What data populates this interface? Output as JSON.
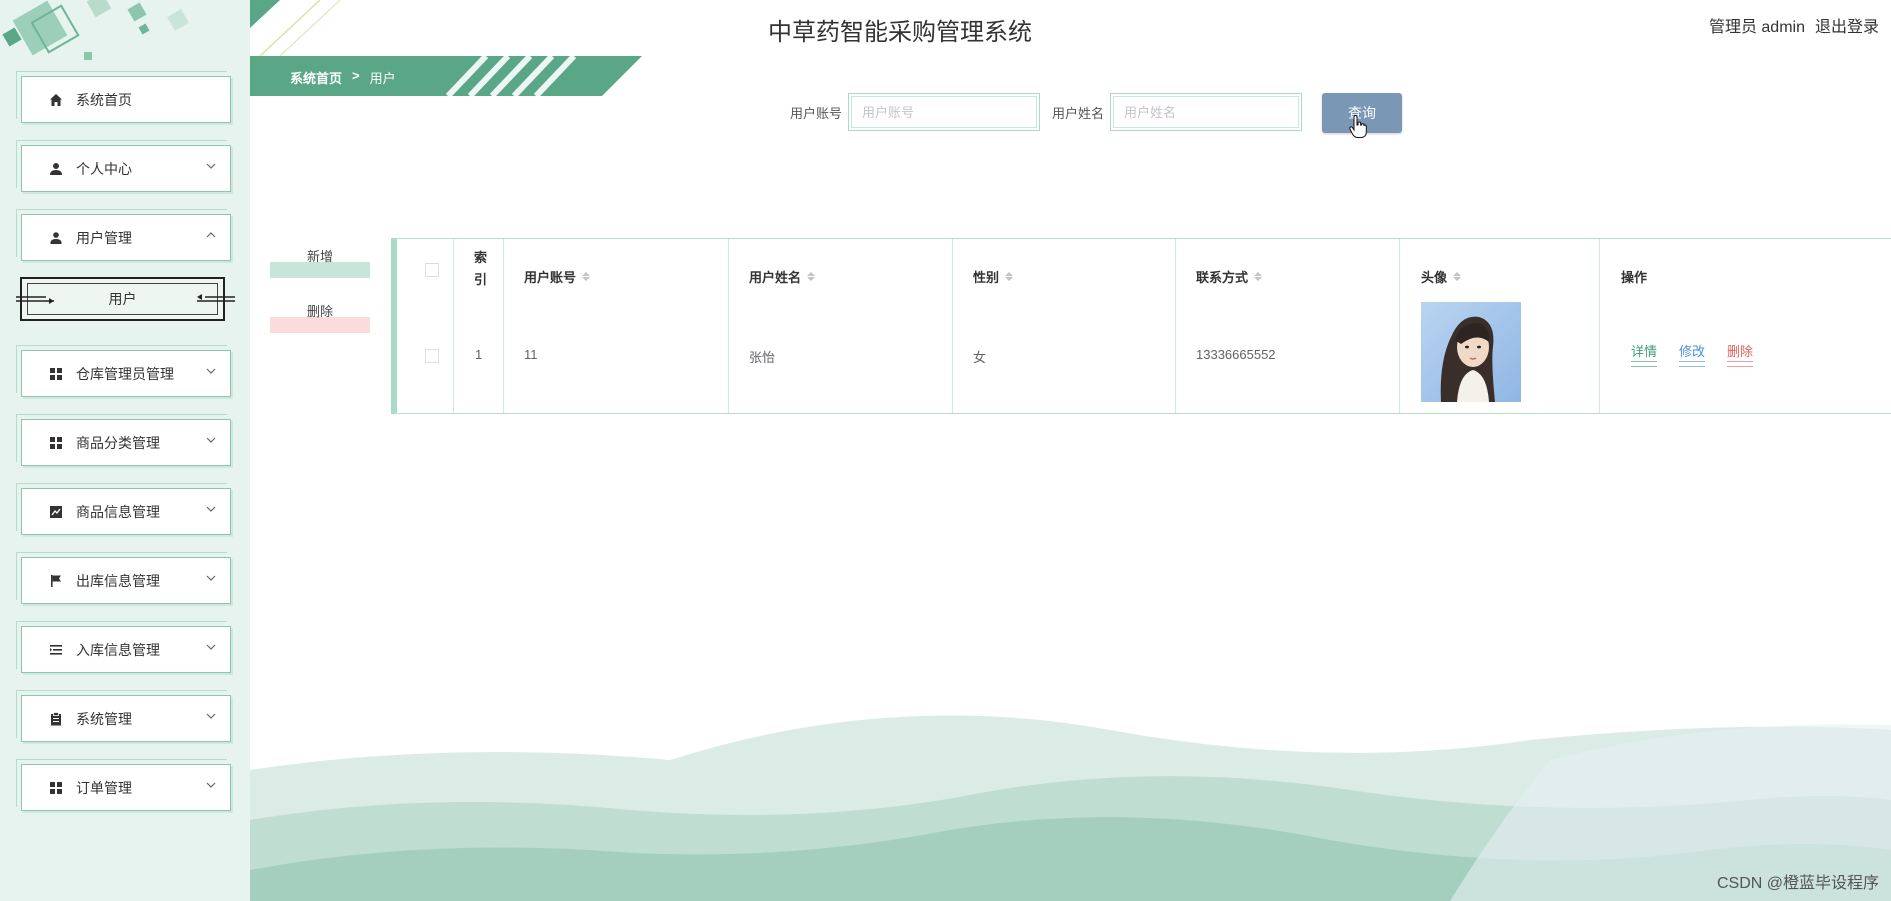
{
  "header": {
    "title": "中草药智能采购管理系统",
    "user_label": "管理员 admin",
    "logout_label": "退出登录"
  },
  "breadcrumb": {
    "home": "系统首页",
    "separator": ">",
    "current": "用户"
  },
  "sidebar": {
    "items": [
      {
        "label": "系统首页",
        "icon": "home-icon"
      },
      {
        "label": "个人中心",
        "icon": "person-icon"
      },
      {
        "label": "用户管理",
        "icon": "user-icon"
      },
      {
        "label": "仓库管理员管理",
        "icon": "grid-icon"
      },
      {
        "label": "商品分类管理",
        "icon": "grid-icon"
      },
      {
        "label": "商品信息管理",
        "icon": "chart-icon"
      },
      {
        "label": "出库信息管理",
        "icon": "flag-icon"
      },
      {
        "label": "入库信息管理",
        "icon": "list-icon"
      },
      {
        "label": "系统管理",
        "icon": "clipboard-icon"
      },
      {
        "label": "订单管理",
        "icon": "grid-icon"
      }
    ],
    "active_sub": "用户"
  },
  "search": {
    "account_label": "用户账号",
    "account_placeholder": "用户账号",
    "name_label": "用户姓名",
    "name_placeholder": "用户姓名",
    "query_label": "查询"
  },
  "actions": {
    "add_label": "新增",
    "delete_label": "删除"
  },
  "table": {
    "headers": {
      "index": "索引",
      "account": "用户账号",
      "name": "用户姓名",
      "gender": "性别",
      "phone": "联系方式",
      "avatar": "头像",
      "ops": "操作"
    },
    "rows": [
      {
        "index": "1",
        "account": "11",
        "name": "张怡",
        "gender": "女",
        "phone": "13336665552"
      }
    ],
    "row_actions": {
      "detail": "详情",
      "edit": "修改",
      "delete": "删除"
    }
  },
  "watermark": "CSDN @橙蓝毕设程序",
  "colors": {
    "sidebar_bg": "#e7f3ee",
    "accent": "#5aa788",
    "query_btn": "#7a98b5",
    "edit": "#4a90d9",
    "delete": "#e0605c"
  }
}
